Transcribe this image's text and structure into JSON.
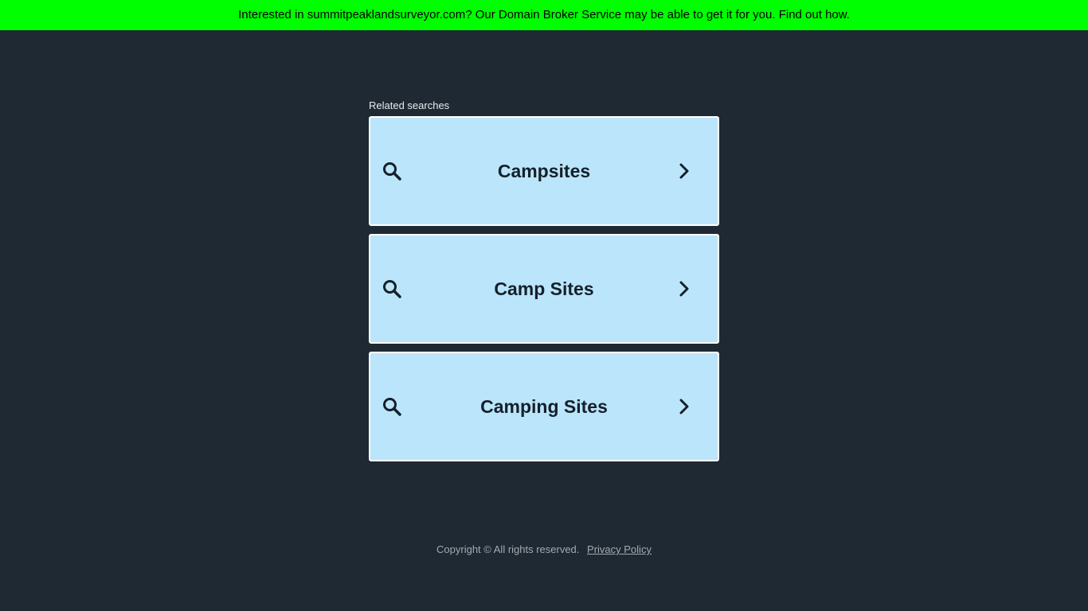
{
  "banner": {
    "text": "Interested in summitpeaklandsurveyor.com? Our Domain Broker Service may be able to get it for you. Find out how."
  },
  "related": {
    "label": "Related searches",
    "items": [
      {
        "label": "Campsites",
        "icon": "search-icon",
        "arrow": "chevron-right-icon"
      },
      {
        "label": "Camp Sites",
        "icon": "search-icon",
        "arrow": "chevron-right-icon"
      },
      {
        "label": "Camping Sites",
        "icon": "search-icon",
        "arrow": "chevron-right-icon"
      }
    ]
  },
  "footer": {
    "copyright": "Copyright ©  All rights reserved.",
    "privacy_link": "Privacy Policy"
  },
  "colors": {
    "background": "#1f2933",
    "banner": "#00ff00",
    "card": "#bbe5fa",
    "card_border": "#ffffff",
    "card_text": "#14202b"
  }
}
